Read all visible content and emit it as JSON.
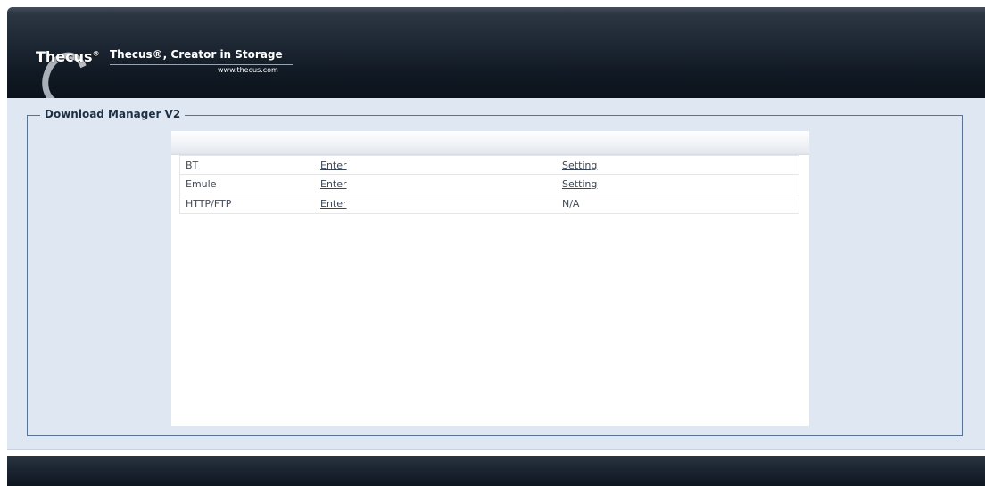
{
  "header": {
    "logo_text": "Thecus",
    "logo_mark": "®",
    "tagline": "Thecus®, Creator in Storage",
    "url": "www.thecus.com"
  },
  "panel": {
    "legend": "Download Manager V2"
  },
  "table": {
    "rows": [
      {
        "name": "BT",
        "enter": "Enter",
        "setting": "Setting",
        "setting_is_link": true
      },
      {
        "name": "Emule",
        "enter": "Enter",
        "setting": "Setting",
        "setting_is_link": true
      },
      {
        "name": "HTTP/FTP",
        "enter": "Enter",
        "setting": "N/A",
        "setting_is_link": false
      }
    ]
  },
  "colors": {
    "header_dark": "#111a25",
    "panel_bg": "#dfe7f2",
    "border": "#5a7392"
  }
}
